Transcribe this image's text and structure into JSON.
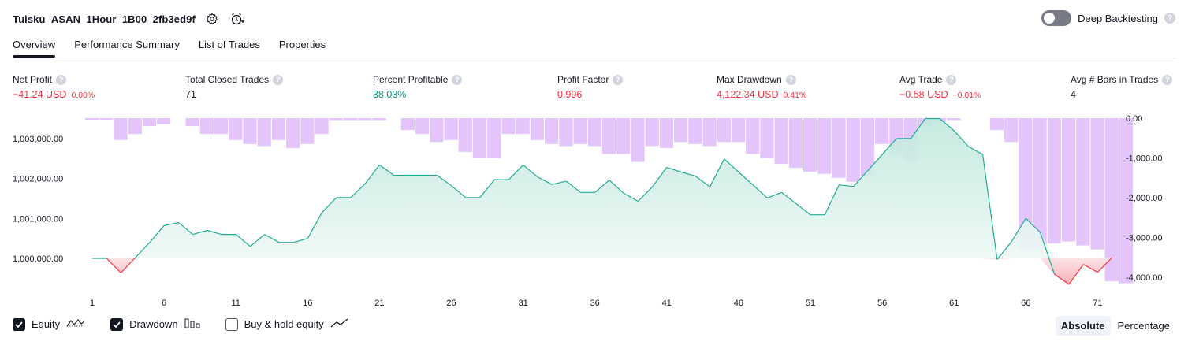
{
  "header": {
    "strategy_title": "Tuisku_ASAN_1Hour_1B00_2fb3ed9f",
    "settings_icon": "gear-icon",
    "alert_icon": "add-alert-icon",
    "deep_backtesting_label": "Deep Backtesting",
    "deep_backtesting_enabled": false
  },
  "tabs": [
    {
      "label": "Overview",
      "active": true
    },
    {
      "label": "Performance Summary",
      "active": false
    },
    {
      "label": "List of Trades",
      "active": false
    },
    {
      "label": "Properties",
      "active": false
    }
  ],
  "metrics": {
    "net_profit": {
      "label": "Net Profit",
      "value": "−41.24 USD",
      "pct": "0.00%"
    },
    "total_closed_trades": {
      "label": "Total Closed Trades",
      "value": "71"
    },
    "percent_profitable": {
      "label": "Percent Profitable",
      "value": "38.03%"
    },
    "profit_factor": {
      "label": "Profit Factor",
      "value": "0.996"
    },
    "max_drawdown": {
      "label": "Max Drawdown",
      "value": "4,122.34 USD",
      "pct": "0.41%"
    },
    "avg_trade": {
      "label": "Avg Trade",
      "value": "−0.58 USD",
      "pct": "−0.01%"
    },
    "avg_bars": {
      "label": "Avg # Bars in Trades",
      "value": "4"
    }
  },
  "legend": {
    "equity": {
      "label": "Equity",
      "checked": true
    },
    "drawdown": {
      "label": "Drawdown",
      "checked": true
    },
    "buy_hold": {
      "label": "Buy & hold equity",
      "checked": false
    }
  },
  "modes": {
    "absolute": "Absolute",
    "percentage": "Percentage",
    "selected": "Absolute"
  },
  "colors": {
    "equity_line": "#22ab94",
    "equity_fill_top": "#bfe8dd",
    "negative": "#f23645",
    "drawdown_bar": "#e1c2fb",
    "positive_text": "#089981"
  },
  "chart_data": {
    "type": "area",
    "x_ticks": [
      "1",
      "6",
      "11",
      "16",
      "21",
      "26",
      "31",
      "36",
      "41",
      "46",
      "51",
      "56",
      "61",
      "66",
      "71"
    ],
    "left_ticks": [
      "1,003,000.00",
      "1,002,000.00",
      "1,001,000.00",
      "1,000,000.00"
    ],
    "left_tick_values": [
      1003000,
      1002000,
      1001000,
      1000000
    ],
    "right_ticks": [
      "0.00",
      "-1,000.00",
      "-2,000.00",
      "-3,000.00",
      "-4,000.00"
    ],
    "right_tick_values": [
      0,
      -1000,
      -2000,
      -3000,
      -4000
    ],
    "equity_ylim": [
      999600,
      1003550
    ],
    "drawdown_ylim": [
      -4300,
      0
    ],
    "baseline": 1000000,
    "series": [
      {
        "name": "Equity",
        "x": [
          1,
          2,
          3,
          4,
          5,
          6,
          7,
          8,
          9,
          10,
          11,
          12,
          13,
          14,
          15,
          16,
          17,
          18,
          19,
          20,
          21,
          22,
          23,
          24,
          25,
          26,
          27,
          28,
          29,
          30,
          31,
          32,
          33,
          34,
          35,
          36,
          37,
          38,
          39,
          40,
          41,
          42,
          43,
          44,
          45,
          46,
          47,
          48,
          49,
          50,
          51,
          52,
          53,
          54,
          55,
          56,
          57,
          58,
          59,
          60,
          61,
          62,
          63,
          64,
          65,
          66,
          67,
          68,
          69,
          70,
          71,
          72
        ],
        "values": [
          1000000,
          1000000,
          999640,
          1000020,
          1000400,
          1000820,
          1000900,
          1000600,
          1000700,
          1000600,
          1000600,
          1000300,
          1000600,
          1000400,
          1000400,
          1000500,
          1001150,
          1001520,
          1001520,
          1001870,
          1002340,
          1002080,
          1002080,
          1002080,
          1002080,
          1001820,
          1001520,
          1001520,
          1001970,
          1001970,
          1002340,
          1002040,
          1001850,
          1001930,
          1001650,
          1001650,
          1001960,
          1001630,
          1001430,
          1001790,
          1002280,
          1002160,
          1002060,
          1001790,
          1002490,
          1002160,
          1001840,
          1001510,
          1001650,
          1001370,
          1001090,
          1001090,
          1001840,
          1001800,
          1002200,
          1002600,
          1003000,
          1003000,
          1003500,
          1003500,
          1003200,
          1002800,
          1002600,
          999970,
          1000420,
          1001000,
          1000650,
          999600,
          999350,
          999850,
          999650,
          1000020
        ]
      },
      {
        "name": "Drawdown",
        "values": [
          -40,
          -40,
          -550,
          -400,
          -200,
          -150,
          0,
          -200,
          -400,
          -400,
          -550,
          -650,
          -700,
          -550,
          -750,
          -650,
          -400,
          -50,
          -50,
          -50,
          -50,
          0,
          -300,
          -400,
          -600,
          -550,
          -850,
          -1000,
          -1000,
          -400,
          -400,
          -550,
          -650,
          -700,
          -650,
          -700,
          -900,
          -900,
          -1100,
          -700,
          -750,
          -600,
          -650,
          -700,
          -600,
          -600,
          -900,
          -1000,
          -1150,
          -1250,
          -1350,
          -1400,
          -1500,
          -1600,
          -1450,
          -650,
          -900,
          -1100,
          -200,
          -100,
          -50,
          0,
          0,
          -300,
          -600,
          -3300,
          -3300,
          -3150,
          -3100,
          -3200,
          -3300,
          -4100,
          -4150
        ]
      }
    ],
    "legend_position": "bottom-left",
    "grid": false
  }
}
